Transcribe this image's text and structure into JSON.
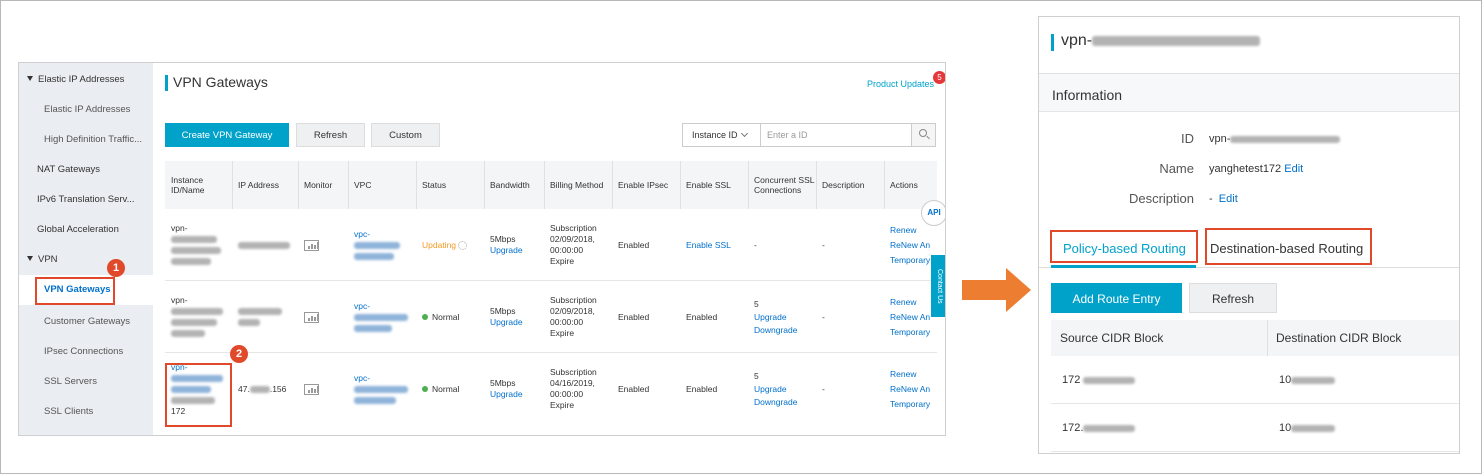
{
  "console": {
    "sidebar": {
      "items": [
        {
          "label": "Elastic IP Addresses",
          "level": "group"
        },
        {
          "label": "Elastic IP Addresses",
          "level": "lvl2"
        },
        {
          "label": "High Definition Traffic...",
          "level": "lvl2"
        },
        {
          "label": "NAT Gateways",
          "level": "lvl1"
        },
        {
          "label": "IPv6 Translation Serv...",
          "level": "lvl1"
        },
        {
          "label": "Global Acceleration",
          "level": "lvl1"
        },
        {
          "label": "VPN",
          "level": "group"
        },
        {
          "label": "VPN Gateways",
          "level": "lvl2",
          "active": true
        },
        {
          "label": "Customer Gateways",
          "level": "lvl2"
        },
        {
          "label": "IPsec Connections",
          "level": "lvl2"
        },
        {
          "label": "SSL Servers",
          "level": "lvl2"
        },
        {
          "label": "SSL Clients",
          "level": "lvl2"
        }
      ]
    },
    "page_title": "VPN Gateways",
    "product_updates": "Product Updates",
    "updates_count": "5",
    "toolbar": {
      "create": "Create VPN Gateway",
      "refresh": "Refresh",
      "custom": "Custom"
    },
    "search": {
      "filter": "Instance ID",
      "placeholder": "Enter a ID"
    },
    "table": {
      "headers": [
        "Instance ID/Name",
        "IP Address",
        "Monitor",
        "VPC",
        "Status",
        "Bandwidth",
        "Billing Method",
        "Enable IPsec",
        "Enable SSL",
        "Concurrent SSL Connections",
        "Description",
        "Actions"
      ],
      "rows": [
        {
          "id_prefix": "vpn-",
          "ip_visible": "",
          "vpc_prefix": "vpc-",
          "status": "Updating",
          "bandwidth": "5Mbps",
          "bandwidth_action": "Upgrade",
          "billing": [
            "Subscription",
            "02/09/2018,",
            "00:00:00",
            "Expire"
          ],
          "ipsec": "Enabled",
          "ssl": "Enable SSL",
          "ssl_conn": "-",
          "ssl_actions": [],
          "description": "-",
          "actions": [
            "Renew",
            "ReNew An",
            "Temporary"
          ]
        },
        {
          "id_prefix": "vpn-",
          "ip_visible": "",
          "vpc_prefix": "vpc-",
          "status": "Normal",
          "bandwidth": "5Mbps",
          "bandwidth_action": "Upgrade",
          "billing": [
            "Subscription",
            "02/09/2018,",
            "00:00:00",
            "Expire"
          ],
          "ipsec": "Enabled",
          "ssl": "Enabled",
          "ssl_conn": "5",
          "ssl_actions": [
            "Upgrade",
            "Downgrade"
          ],
          "description": "-",
          "actions": [
            "Renew",
            "ReNew An",
            "Temporary"
          ]
        },
        {
          "id_prefix": "vpn-",
          "name_suffix": "172",
          "ip_prefix": "47.",
          "ip_suffix": ".156",
          "vpc_prefix": "vpc-",
          "status": "Normal",
          "bandwidth": "5Mbps",
          "bandwidth_action": "Upgrade",
          "billing": [
            "Subscription",
            "04/16/2019,",
            "00:00:00",
            "Expire"
          ],
          "ipsec": "Enabled",
          "ssl": "Enabled",
          "ssl_conn": "5",
          "ssl_actions": [
            "Upgrade",
            "Downgrade"
          ],
          "description": "-",
          "actions": [
            "Renew",
            "ReNew An",
            "Temporary"
          ]
        }
      ]
    },
    "api_label": "API",
    "contact_us": "Contact Us",
    "callouts": [
      "1",
      "2"
    ]
  },
  "detail": {
    "title_prefix": "vpn-",
    "info_title": "Information",
    "fields": {
      "id_label": "ID",
      "id_prefix": "vpn-",
      "name_label": "Name",
      "name_value": "yanghetest172",
      "edit": "Edit",
      "description_label": "Description",
      "description_value": "-"
    },
    "tabs": [
      "Policy-based Routing",
      "Destination-based Routing"
    ],
    "buttons": {
      "add": "Add Route Entry",
      "refresh": "Refresh"
    },
    "route_table": {
      "headers": [
        "Source CIDR Block",
        "Destination CIDR Block"
      ],
      "rows": [
        {
          "source_prefix": "172",
          "dest_prefix": "10"
        },
        {
          "source_prefix": "172.",
          "dest_prefix": "10"
        }
      ]
    }
  },
  "colors": {
    "accent": "#00a2ca",
    "link": "#0070cc",
    "highlight": "#e04a2a",
    "arrow": "#ed7d31",
    "status_normal": "#4caf50",
    "status_updating": "#f59b22"
  }
}
